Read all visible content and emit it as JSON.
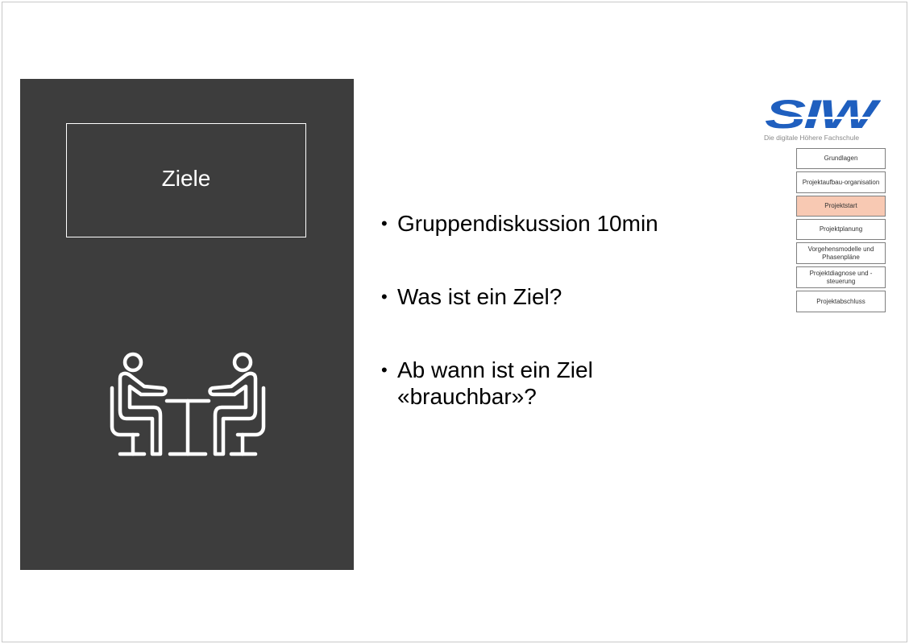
{
  "slide": {
    "panel_title": "Ziele",
    "meeting_icon": "meeting-icon",
    "bullets": [
      {
        "text": "Gruppendiskussion 10min"
      },
      {
        "text": "Was ist ein Ziel?"
      },
      {
        "text": "Ab wann ist ein Ziel «brauchbar»?"
      }
    ]
  },
  "logo": {
    "brand": "SIW",
    "tagline": "Die digitale Höhere Fachschule",
    "color": "#1f5fbf"
  },
  "nav": {
    "items": [
      {
        "label": "Grundlagen",
        "active": false
      },
      {
        "label": "Projektaufbau-organisation",
        "active": false
      },
      {
        "label": "Projektstart",
        "active": true
      },
      {
        "label": "Projektplanung",
        "active": false
      },
      {
        "label": "Vorgehensmodelle und Phasenpläne",
        "active": false
      },
      {
        "label": "Projektdiagnose und -steuerung",
        "active": false
      },
      {
        "label": "Projektabschluss",
        "active": false
      }
    ],
    "active_color": "#f8c9b3"
  },
  "colors": {
    "panel": "#3d3d3d",
    "panel_text": "#ffffff"
  }
}
